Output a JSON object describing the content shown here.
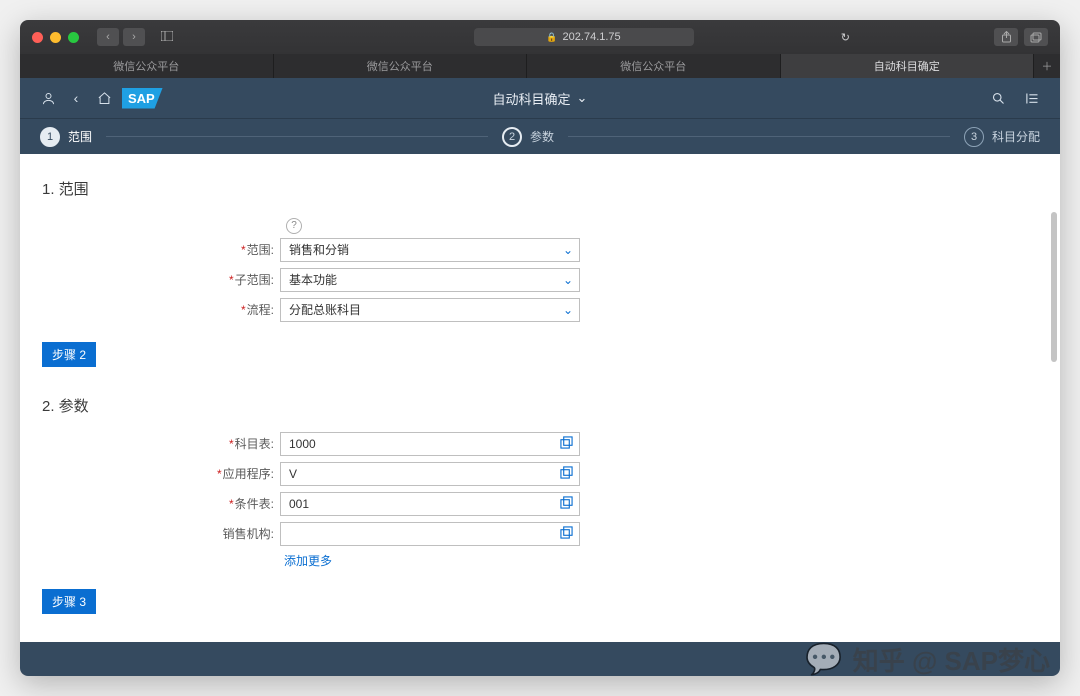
{
  "browser": {
    "address": "202.74.1.75",
    "tabs": [
      "微信公众平台",
      "微信公众平台",
      "微信公众平台",
      "自动科目确定"
    ],
    "active_tab_index": 3
  },
  "header": {
    "logo": "SAP",
    "title": "自动科目确定"
  },
  "wizard": {
    "steps": [
      {
        "num": "1",
        "label": "范围"
      },
      {
        "num": "2",
        "label": "参数"
      },
      {
        "num": "3",
        "label": "科目分配"
      }
    ]
  },
  "section1": {
    "heading": "1. 范围",
    "help_icon": "?",
    "rows": {
      "scope": {
        "label": "范围:",
        "value": "销售和分销",
        "required": true
      },
      "subscope": {
        "label": "子范围:",
        "value": "基本功能",
        "required": true
      },
      "process": {
        "label": "流程:",
        "value": "分配总账科目",
        "required": true
      }
    },
    "step_button": "步骤 2"
  },
  "section2": {
    "heading": "2. 参数",
    "rows": {
      "coa": {
        "label": "科目表:",
        "value": "1000",
        "required": true
      },
      "app": {
        "label": "应用程序:",
        "value": "V",
        "required": true
      },
      "cond": {
        "label": "条件表:",
        "value": "001",
        "required": true
      },
      "sorg": {
        "label": "销售机构:",
        "value": "",
        "required": false
      }
    },
    "add_more": "添加更多",
    "step_button": "步骤 3"
  },
  "footer": {
    "left": "",
    "right": ""
  },
  "watermark": "知乎 @ SAP梦心"
}
